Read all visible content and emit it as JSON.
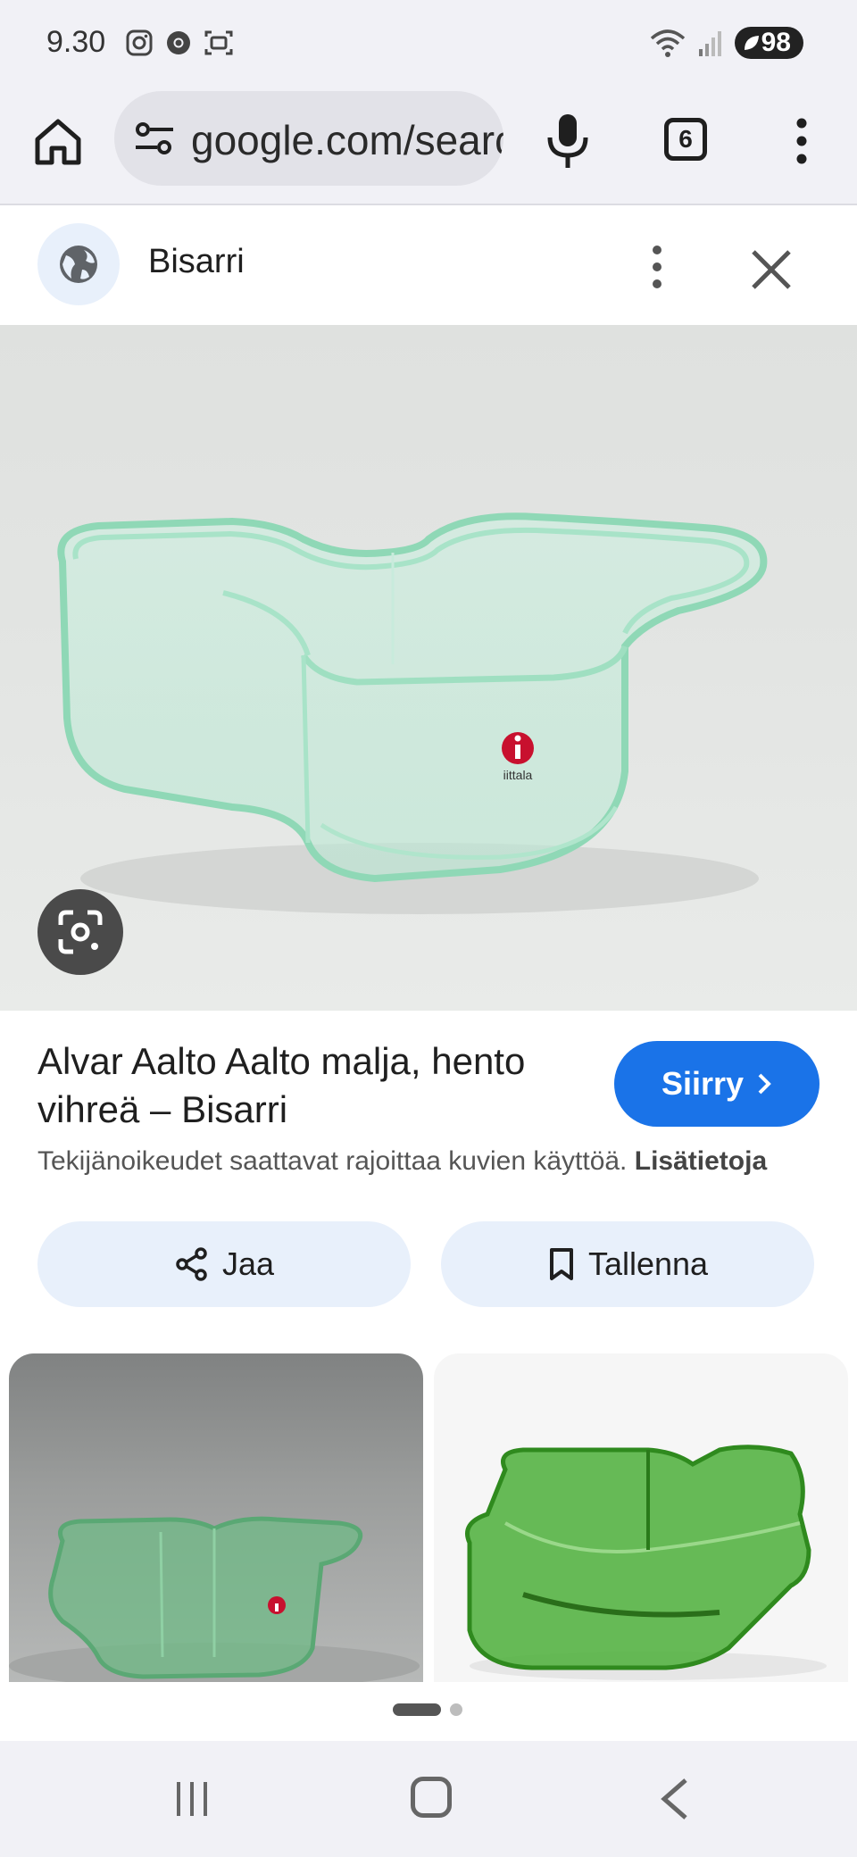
{
  "status_bar": {
    "time": "9.30",
    "battery": "98",
    "icons_left": [
      "instagram-icon",
      "chrome-icon",
      "screenshot-icon"
    ],
    "icons_right": [
      "wifi-icon",
      "signal-icon",
      "battery-icon"
    ]
  },
  "browser": {
    "url": "google.com/search",
    "tab_count": "6",
    "icons": [
      "home-icon",
      "tune-icon",
      "mic-icon",
      "tabs-icon",
      "more-vert-icon"
    ]
  },
  "source": {
    "name": "Bisarri",
    "icons": [
      "globe-icon",
      "more-vert-icon",
      "close-icon"
    ]
  },
  "hero": {
    "logo_text": "iittala",
    "lens_icon": "google-lens-icon"
  },
  "result": {
    "title": "Alvar Aalto Aalto malja, hento vihreä – Bisarri",
    "visit_label": "Siirry",
    "copyright_text": "Tekijänoikeudet saattavat rajoittaa kuvien käyttöä.",
    "copyright_link": "Lisätietoja"
  },
  "actions": {
    "share_label": "Jaa",
    "save_label": "Tallenna"
  },
  "pager": {
    "current": 1,
    "total": 2
  },
  "colors": {
    "accent": "#1a73e8",
    "chip_bg": "#e8f0fb",
    "toolbar_bg": "#f1f1f6",
    "glass_green": "#7fd3a8"
  },
  "nav": {
    "icons": [
      "recent-apps-icon",
      "home-button-icon",
      "back-icon"
    ]
  }
}
